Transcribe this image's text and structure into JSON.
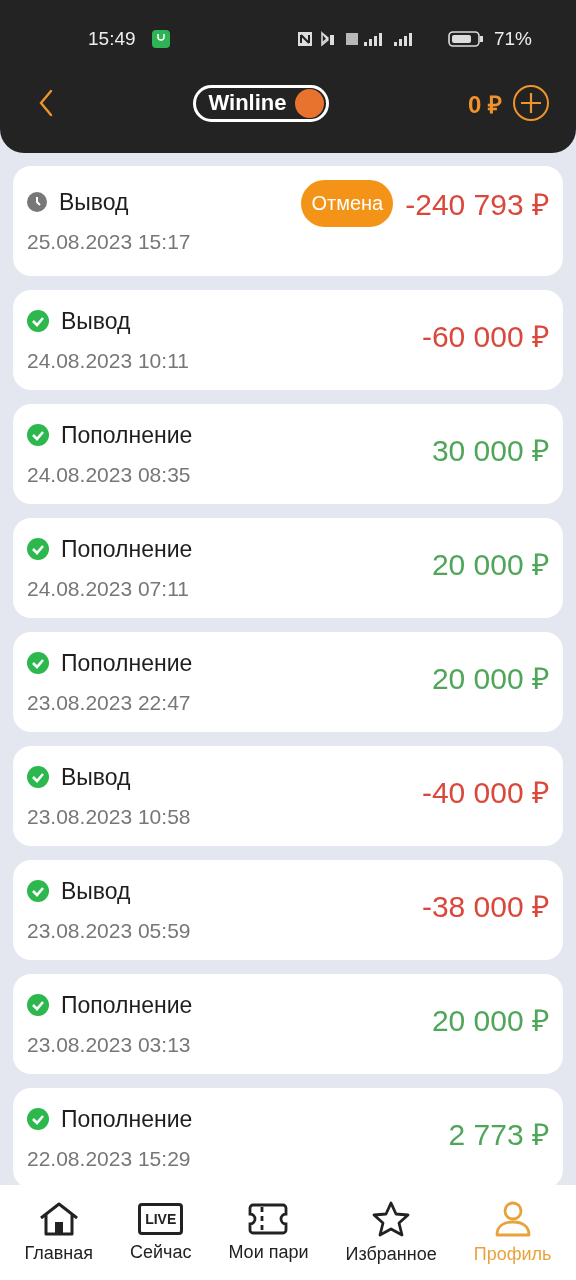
{
  "status_bar": {
    "time": "15:49",
    "battery": "71%"
  },
  "header": {
    "logo": "Winline",
    "balance": "0 ₽"
  },
  "transactions": [
    {
      "title": "Вывод",
      "date": "25.08.2023 15:17",
      "amount": "-240 793 ₽",
      "kind": "withdrawal",
      "completed": false,
      "action": "Отмена"
    },
    {
      "title": "Вывод",
      "date": "24.08.2023 10:11",
      "amount": "-60 000 ₽",
      "kind": "withdrawal",
      "completed": true
    },
    {
      "title": "Пополнение",
      "date": "24.08.2023 08:35",
      "amount": "30 000 ₽",
      "kind": "deposit",
      "completed": true
    },
    {
      "title": "Пополнение",
      "date": "24.08.2023 07:11",
      "amount": "20 000 ₽",
      "kind": "deposit",
      "completed": true
    },
    {
      "title": "Пополнение",
      "date": "23.08.2023 22:47",
      "amount": "20 000 ₽",
      "kind": "deposit",
      "completed": true
    },
    {
      "title": "Вывод",
      "date": "23.08.2023 10:58",
      "amount": "-40 000 ₽",
      "kind": "withdrawal",
      "completed": true
    },
    {
      "title": "Вывод",
      "date": "23.08.2023 05:59",
      "amount": "-38 000 ₽",
      "kind": "withdrawal",
      "completed": true
    },
    {
      "title": "Пополнение",
      "date": "23.08.2023 03:13",
      "amount": "20 000 ₽",
      "kind": "deposit",
      "completed": true
    },
    {
      "title": "Пополнение",
      "date": "22.08.2023 15:29",
      "amount": "2 773 ₽",
      "kind": "deposit",
      "completed": true
    }
  ],
  "bottom_nav": [
    {
      "label": "Главная",
      "selected": false
    },
    {
      "label": "Сейчас",
      "icon_text": "LIVE",
      "selected": false
    },
    {
      "label": "Мои пари",
      "selected": false
    },
    {
      "label": "Избранное",
      "selected": false
    },
    {
      "label": "Профиль",
      "selected": true
    }
  ]
}
